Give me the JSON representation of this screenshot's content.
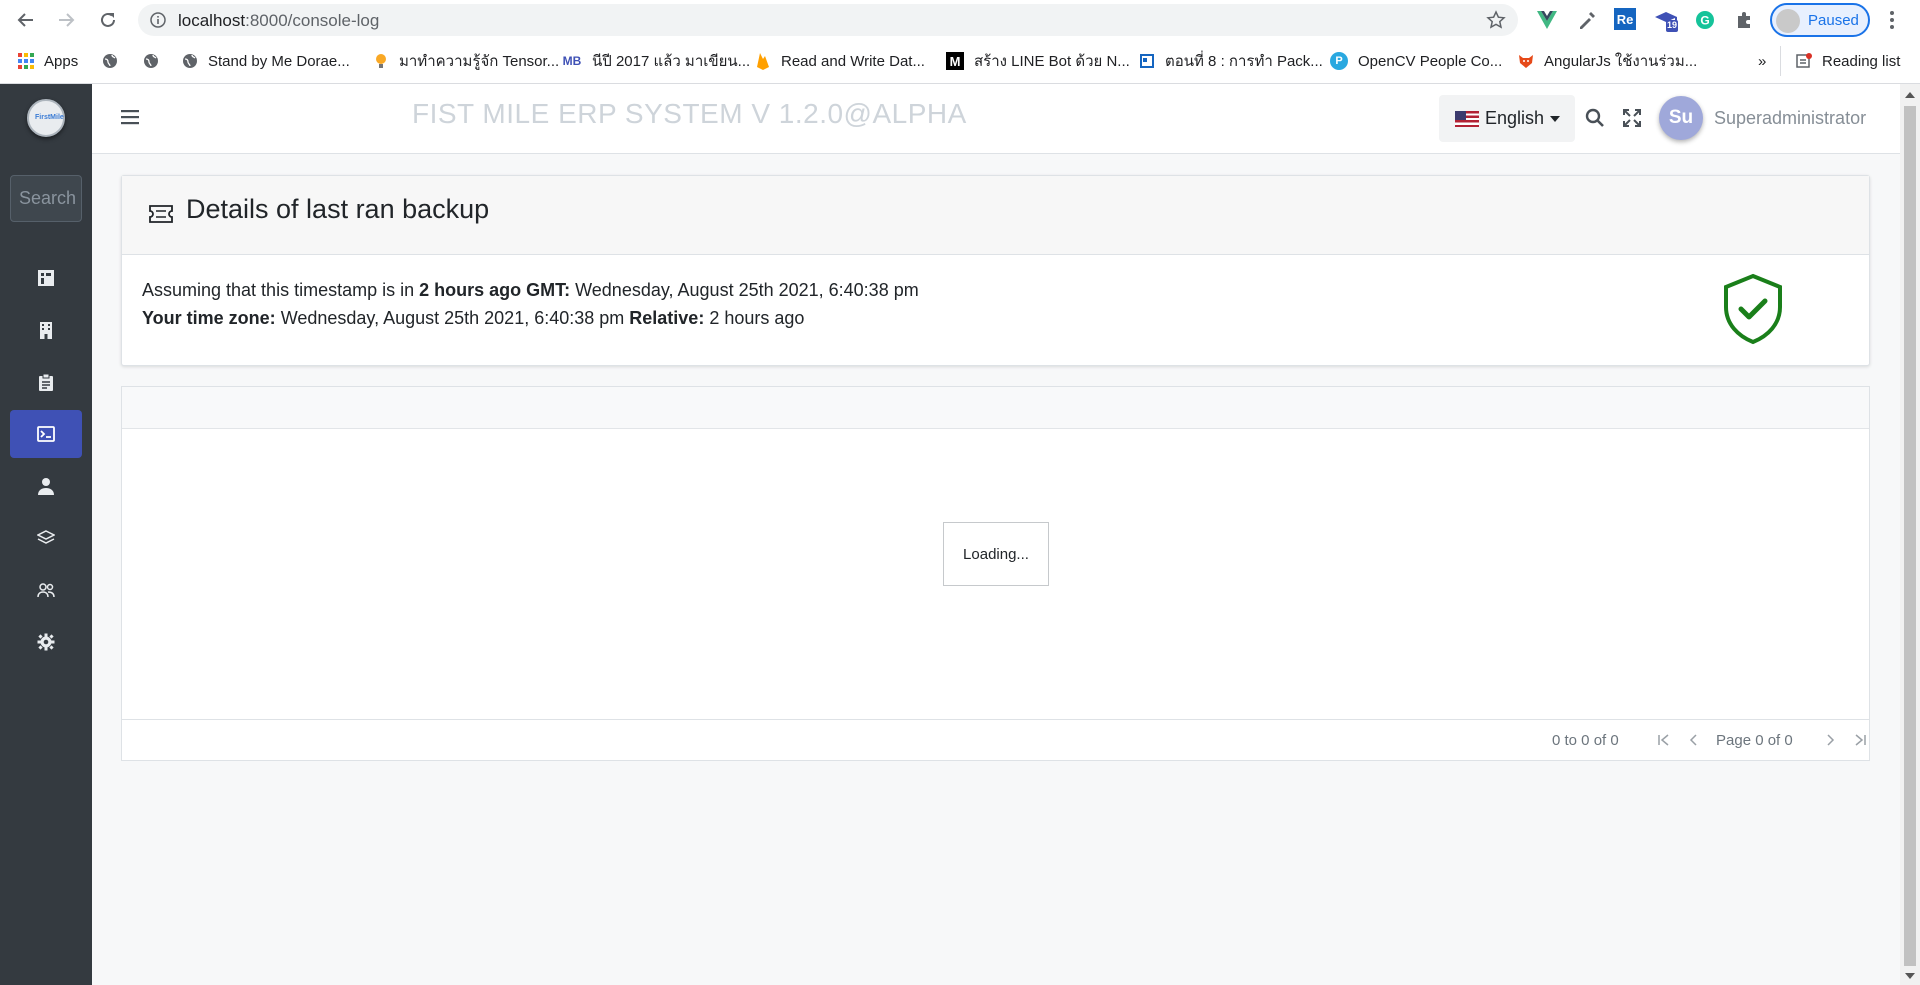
{
  "browser": {
    "url_host": "localhost",
    "url_path": ":8000/console-log",
    "profile_status": "Paused",
    "ext_badge": "19",
    "ext_re_label": "Re",
    "bookmarks": [
      {
        "label": "Apps"
      },
      {
        "label": ""
      },
      {
        "label": ""
      },
      {
        "label": "Stand by Me Dorae..."
      },
      {
        "label": "มาทำความรู้จัก Tensor..."
      },
      {
        "label": "นีปี 2017 แล้ว มาเขียน..."
      },
      {
        "label": "Read and Write Dat..."
      },
      {
        "label": "สร้าง LINE Bot ด้วย N..."
      },
      {
        "label": "ตอนที่ 8 : การทำ Pack..."
      },
      {
        "label": "OpenCV People Co..."
      },
      {
        "label": "AngularJs ใช้งานร่วม..."
      }
    ],
    "more_bookmarks": "»",
    "reading_list": "Reading list"
  },
  "sidebar": {
    "search_placeholder": "Search",
    "items": [
      {
        "icon": "building-columns-icon",
        "active": false
      },
      {
        "icon": "building-icon",
        "active": false
      },
      {
        "icon": "clipboard-icon",
        "active": false
      },
      {
        "icon": "terminal-icon",
        "active": true
      },
      {
        "icon": "user-icon",
        "active": false
      },
      {
        "icon": "layers-icon",
        "active": false
      },
      {
        "icon": "users-icon",
        "active": false
      },
      {
        "icon": "gear-icon",
        "active": false
      }
    ]
  },
  "header": {
    "app_title": "FIST MILE ERP SYSTEM V 1.2.0@ALPHA",
    "language": "English",
    "avatar_initials": "Su",
    "user_name": "Superadministrator"
  },
  "backup": {
    "title": "Details of last ran backup",
    "line1_prefix": "Assuming that this timestamp is in ",
    "line1_bold": "2 hours ago GMT:",
    "line1_value": " Wednesday, August 25th 2021, 6:40:38 pm",
    "line2_label": "Your time zone:",
    "line2_value": " Wednesday, August 25th 2021, 6:40:38 pm ",
    "line2_rel_label": "Relative:",
    "line2_rel_value": " 2 hours ago",
    "status_color": "#1a7f1a"
  },
  "grid": {
    "loading_text": "Loading...",
    "range_text": "0 to 0 of 0",
    "page_text": "Page 0 of 0"
  },
  "colors": {
    "sidebar_bg": "#343a40",
    "active_item": "#3f51b5",
    "avatar_bg": "#9fa8da"
  }
}
